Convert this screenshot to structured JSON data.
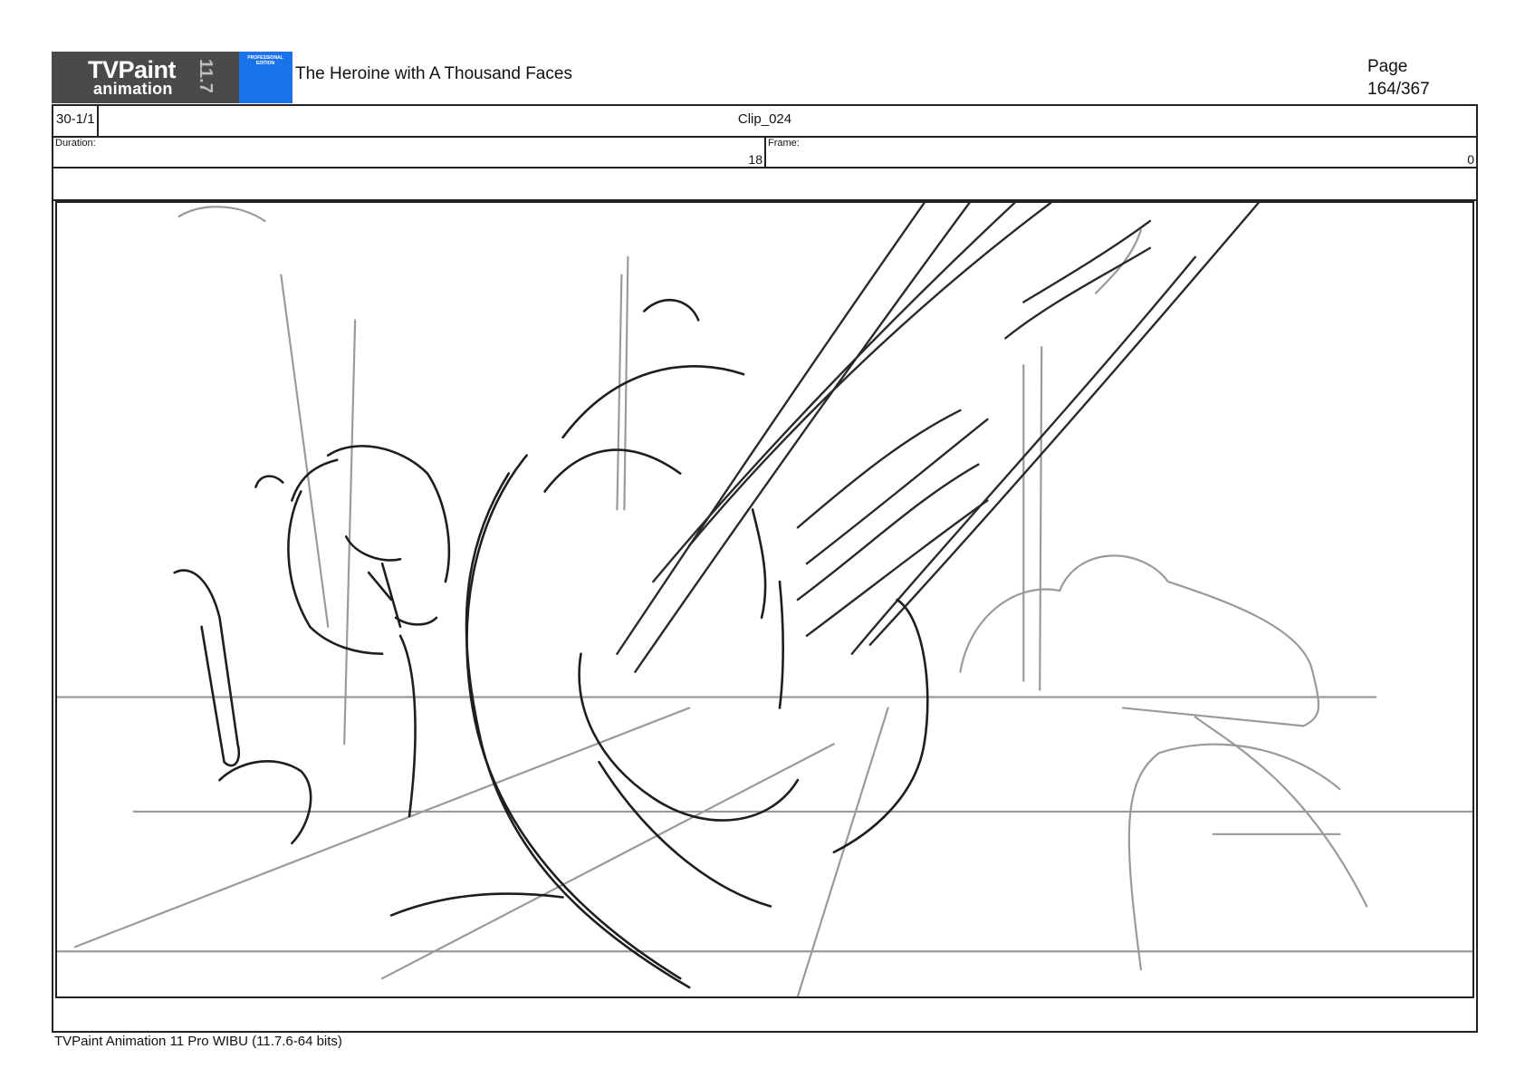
{
  "header": {
    "logo_main": "TVPaint",
    "logo_sub": "animation",
    "logo_version": "11.7",
    "logo_edition": "PROFESSIONAL EDITION",
    "title": "The Heroine with A Thousand Faces",
    "page_label": "Page",
    "page_number": "164/367"
  },
  "shot": {
    "id": "30-1/1",
    "clip": "Clip_024",
    "duration_label": "Duration:",
    "duration_value": "18",
    "frame_label": "Frame:",
    "frame_value": "0"
  },
  "panel": {
    "image": "storyboard-sketch"
  },
  "footer": {
    "text": "TVPaint Animation 11 Pro WIBU (11.7.6-64 bits)"
  },
  "colors": {
    "logo_dark": "#4a4a4a",
    "logo_blue": "#1a73e8",
    "border": "#222222"
  }
}
